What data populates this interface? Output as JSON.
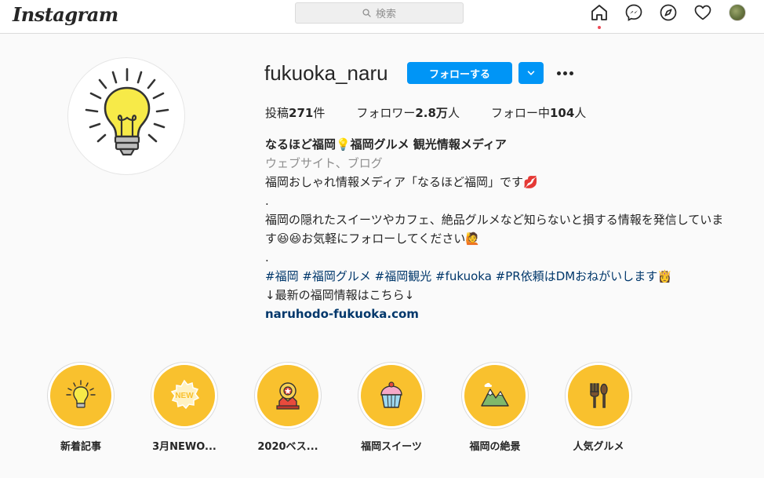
{
  "nav": {
    "logo": "Instagram",
    "search_placeholder": "検索",
    "icons": [
      "home-icon",
      "messenger-icon",
      "explore-icon",
      "heart-icon",
      "avatar"
    ]
  },
  "profile": {
    "username": "fukuoka_naru",
    "follow_label": "フォローする",
    "stats": {
      "posts_prefix": "投稿",
      "posts_value": "271",
      "posts_suffix": "件",
      "followers_prefix": "フォロワー",
      "followers_value": "2.8万",
      "followers_suffix": "人",
      "following_prefix": "フォロー中",
      "following_value": "104",
      "following_suffix": "人"
    },
    "bio": {
      "name": "なるほど福岡💡福岡グルメ 観光情報メディア",
      "category": "ウェブサイト、ブログ",
      "lines": [
        "福岡おしゃれ情報メディア「なるほど福岡」です💋",
        ".",
        "福岡の隠れたスイーツやカフェ、絶品グルメなど知らないと損する情報を発信していま",
        "す😆😆お気軽にフォローしてください🙋",
        "."
      ],
      "tags": "#福岡 #福岡グルメ #福岡観光 #fukuoka #PR依頼はDMおねがいします👸",
      "after_tags": "↓最新の福岡情報はこちら↓",
      "link": "naruhodo-fukuoka.com"
    }
  },
  "highlights": [
    {
      "label": "新着記事",
      "icon": "lightbulb-icon"
    },
    {
      "label": "3月NEWO...",
      "icon": "new-badge-icon"
    },
    {
      "label": "2020ベス...",
      "icon": "award-icon"
    },
    {
      "label": "福岡スイーツ",
      "icon": "cupcake-icon"
    },
    {
      "label": "福岡の絶景",
      "icon": "mountain-icon"
    },
    {
      "label": "人気グルメ",
      "icon": "utensils-icon"
    }
  ],
  "colors": {
    "accent": "#0095f6",
    "highlight_fill": "#f9c12e",
    "link": "#00376b",
    "notification_dot": "#ed4956"
  }
}
